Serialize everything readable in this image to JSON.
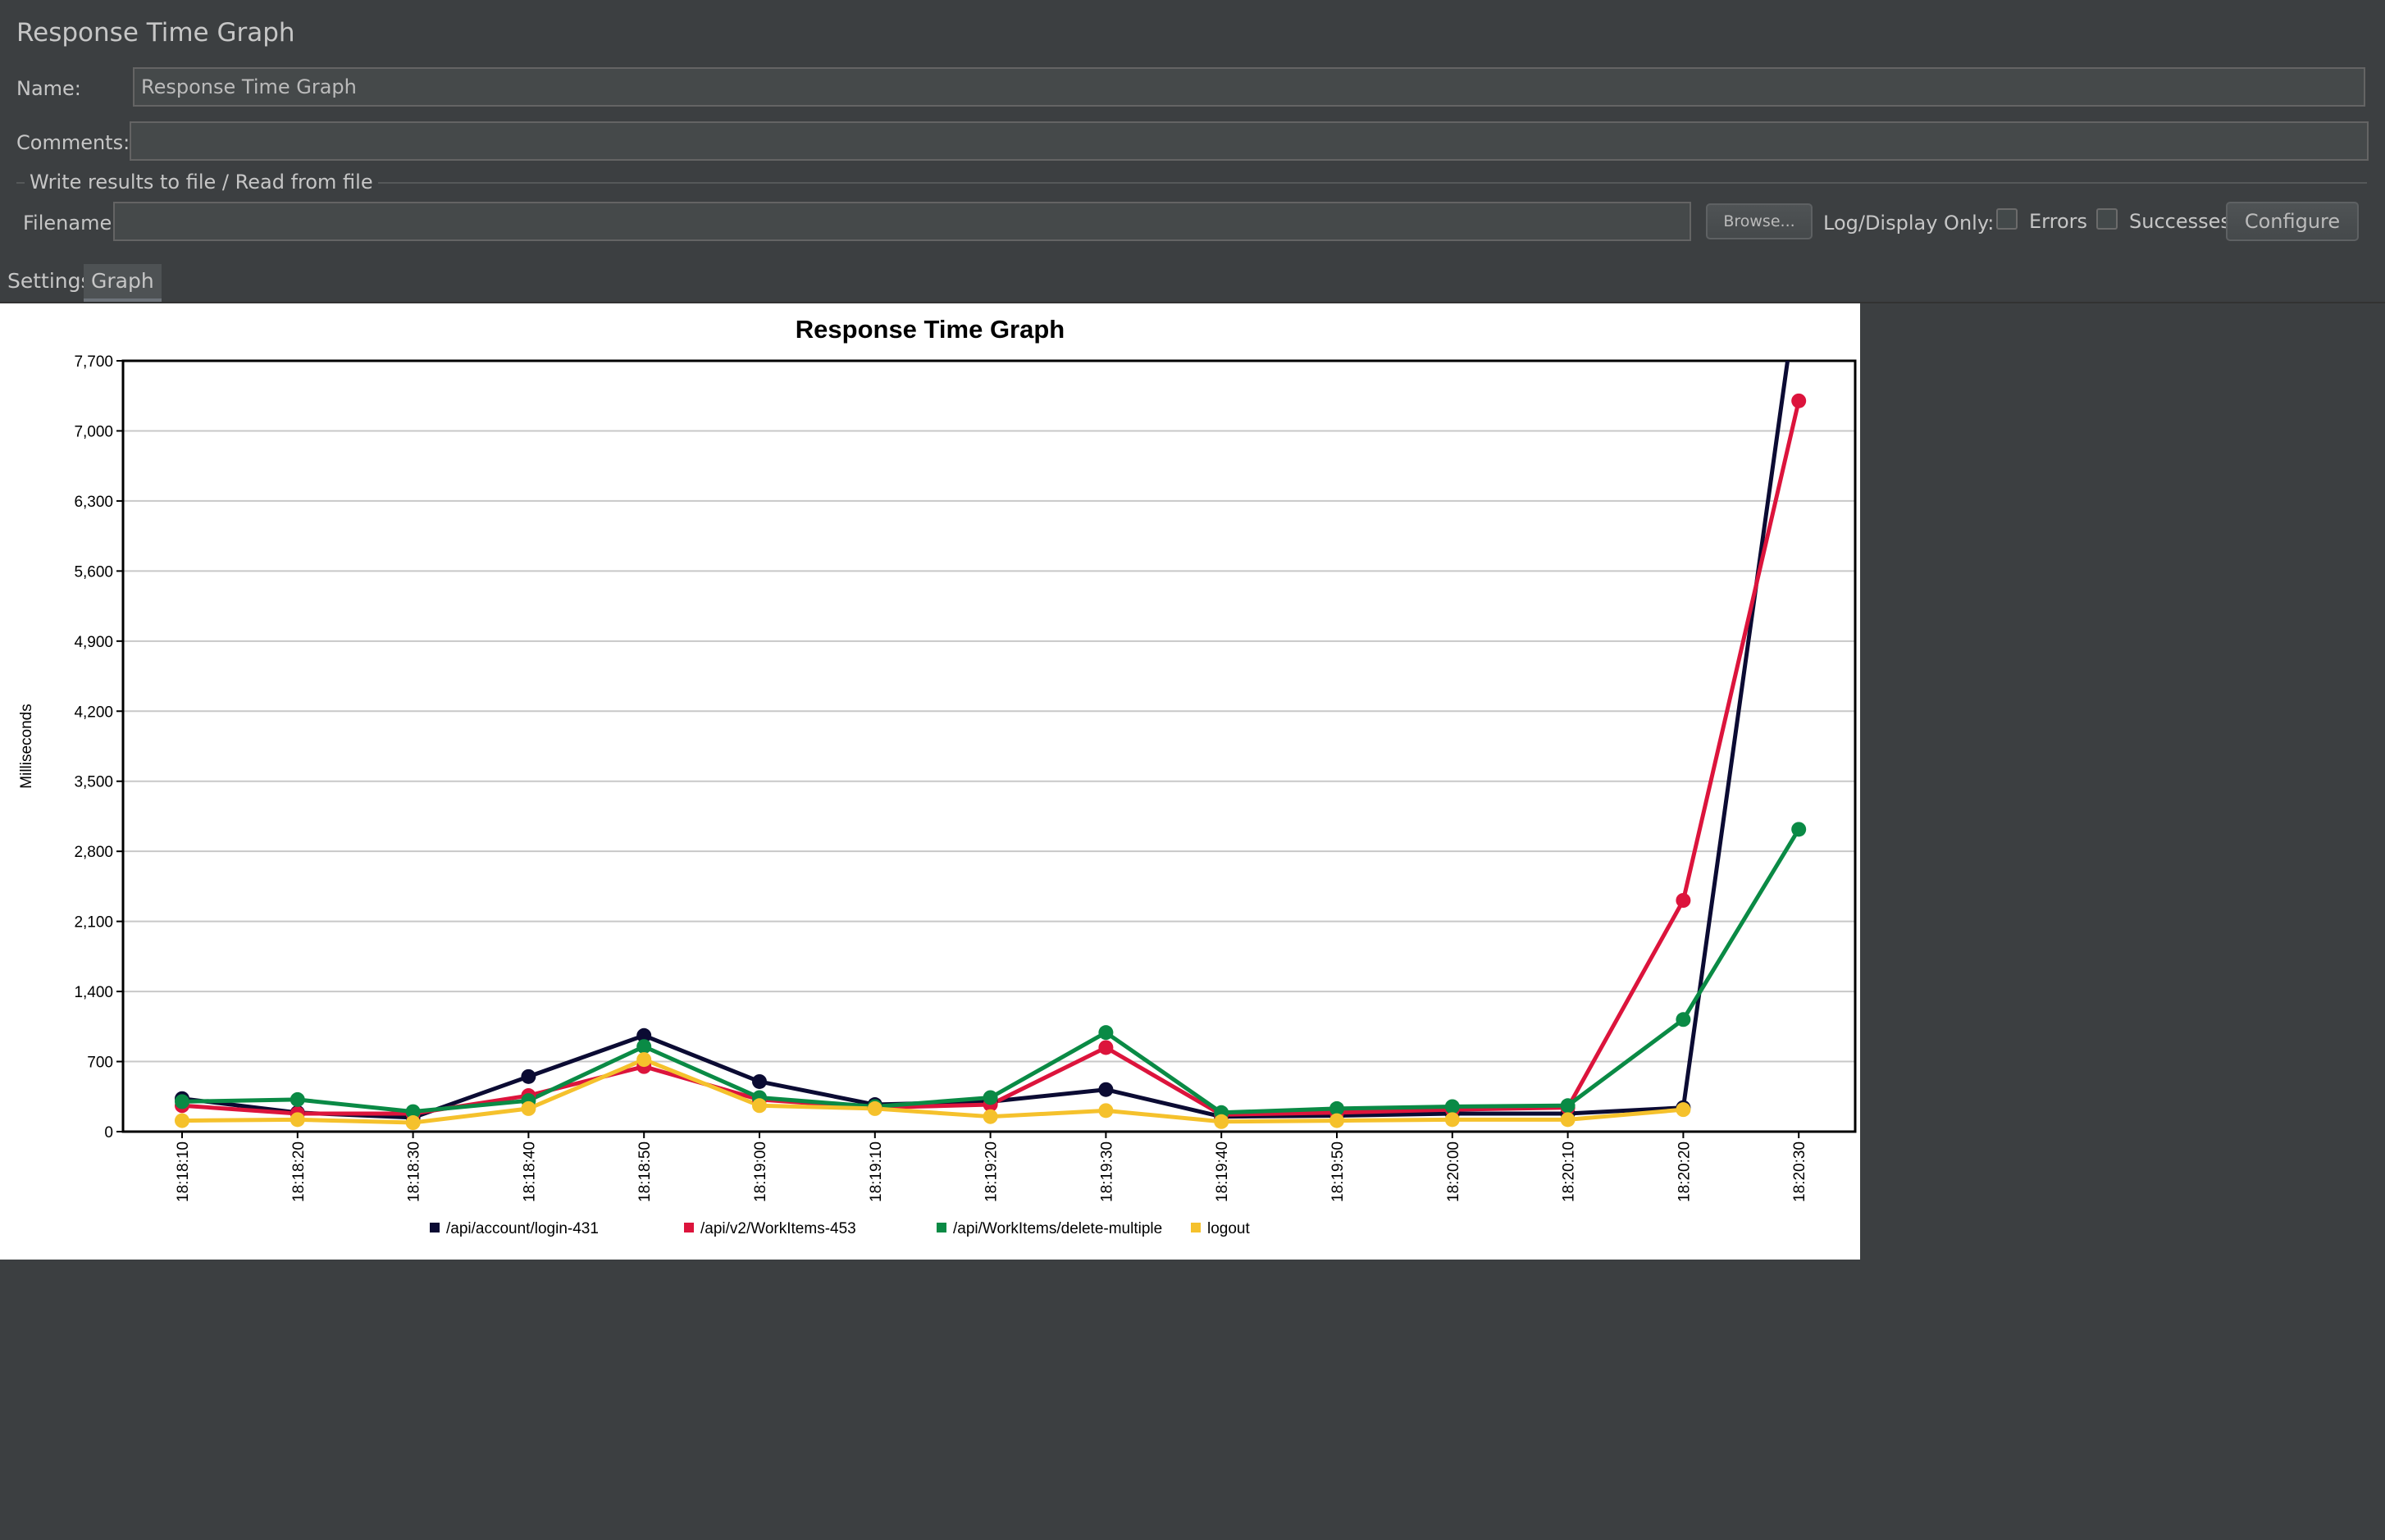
{
  "header": {
    "title": "Response Time Graph",
    "name_label": "Name:",
    "name_value": "Response Time Graph",
    "comments_label": "Comments:",
    "comments_value": ""
  },
  "file_group": {
    "title": "Write results to file / Read from file",
    "filename_label": "Filename",
    "filename_value": "",
    "browse_label": "Browse...",
    "log_display_label": "Log/Display Only:",
    "errors_label": "Errors",
    "successes_label": "Successes",
    "configure_label": "Configure"
  },
  "tabs": [
    {
      "label": "Settings",
      "active": false
    },
    {
      "label": "Graph",
      "active": true
    }
  ],
  "colors": {
    "login": "#0b0b33",
    "workitems": "#dc143c",
    "delete": "#0a8a45",
    "logout": "#f5c12c"
  },
  "chart_data": {
    "type": "line",
    "title": "Response Time Graph",
    "ylabel": "Milliseconds",
    "xlabel": "",
    "ylim": [
      0,
      7700
    ],
    "yticks": [
      0,
      700,
      1400,
      2100,
      2800,
      3500,
      4200,
      4900,
      5600,
      6300,
      7000,
      7700
    ],
    "ytick_labels": [
      "0",
      "700",
      "1,400",
      "2,100",
      "2,800",
      "3,500",
      "4,200",
      "4,900",
      "5,600",
      "6,300",
      "7,000",
      "7,700"
    ],
    "grid": true,
    "legend_position": "bottom",
    "x": [
      "18:18:10",
      "18:18:20",
      "18:18:30",
      "18:18:40",
      "18:18:50",
      "18:19:00",
      "18:19:10",
      "18:19:20",
      "18:19:30",
      "18:19:40",
      "18:19:50",
      "18:20:00",
      "18:20:10",
      "18:20:20",
      "18:20:30"
    ],
    "series": [
      {
        "name": "/api/account/login-431",
        "color": "#0b0b33",
        "values": [
          330,
          190,
          140,
          550,
          960,
          500,
          270,
          300,
          420,
          150,
          160,
          180,
          180,
          240,
          8500
        ]
      },
      {
        "name": "/api/v2/WorkItems-453",
        "color": "#dc143c",
        "values": [
          260,
          180,
          180,
          360,
          650,
          320,
          240,
          270,
          840,
          170,
          190,
          220,
          240,
          2310,
          7300
        ]
      },
      {
        "name": "/api/WorkItems/delete-multiple",
        "color": "#0a8a45",
        "values": [
          300,
          320,
          200,
          310,
          850,
          340,
          250,
          340,
          990,
          190,
          230,
          250,
          260,
          1120,
          3020
        ]
      },
      {
        "name": "logout",
        "color": "#f5c12c",
        "values": [
          110,
          120,
          90,
          230,
          720,
          260,
          230,
          150,
          210,
          100,
          110,
          120,
          120,
          220,
          null
        ]
      }
    ]
  }
}
